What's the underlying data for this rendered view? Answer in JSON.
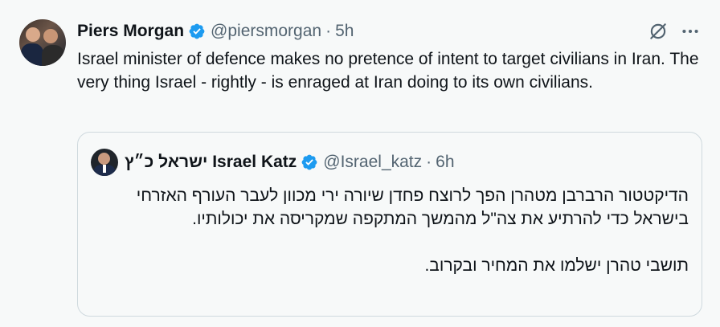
{
  "tweet": {
    "author_name": "Piers Morgan",
    "handle": "@piersmorgan",
    "separator": "·",
    "time": "5h",
    "text": "Israel minister of defence makes no pretence of intent to target civilians in Iran. The very thing Israel - rightly - is enraged at Iran doing to its own civilians."
  },
  "quote": {
    "author_name": "ישראל כ״ץ Israel Katz",
    "handle": "@Israel_katz",
    "separator": "·",
    "time": "6h",
    "paragraph1": "הדיקטטור הרברבן מטהרן הפך לרוצח פחדן שיורה ירי מכוון לעבר העורף האזרחי בישראל כדי להרתיע את צה\"ל מהמשך המתקפה שמקריסה את יכולותיו.",
    "paragraph2": "תושבי טהרן ישלמו את המחיר ובקרוב."
  },
  "icons": {
    "verified": "verified-badge-icon",
    "grok": "grok-icon",
    "more": "more-options-icon"
  },
  "colors": {
    "accent": "#1d9bf0",
    "text": "#0f1419",
    "secondary": "#536471",
    "border": "#cfd9de",
    "background": "#f7f9f9"
  }
}
